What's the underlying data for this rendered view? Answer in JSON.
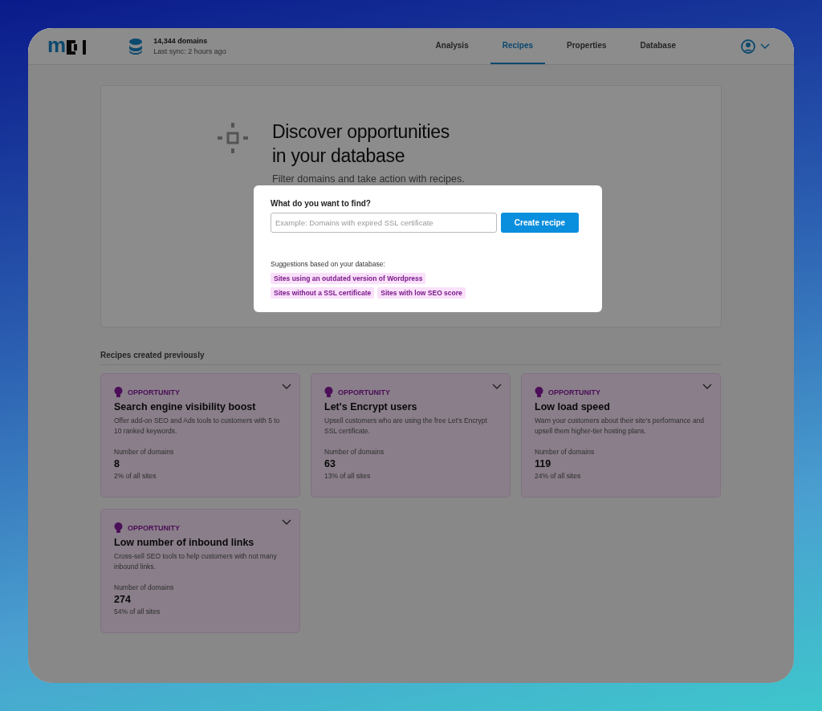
{
  "header": {
    "logo": "m",
    "domains": "14,344 domains",
    "sync": "Last sync: 2 hours ago",
    "tabs": [
      {
        "label": "Analysis",
        "selected": false
      },
      {
        "label": "Recipes",
        "selected": true
      },
      {
        "label": "Properties",
        "selected": false
      },
      {
        "label": "Database",
        "selected": false
      }
    ]
  },
  "hero": {
    "title_lines": [
      "Discover opportunities",
      "in your database"
    ],
    "subtitle": "Filter domains and take action with recipes."
  },
  "dialog": {
    "label": "What do you want to find?",
    "placeholder": "Example: Domains with expired SSL certificate",
    "button": "Create recipe",
    "suggestions_label": "Suggestions based on your database:",
    "suggestions": [
      "Sites using an outdated version of Wordpress",
      "Sites without a SSL certificate",
      "Sites with low SEO score"
    ]
  },
  "recipes": {
    "heading": "Recipes created previously",
    "cards": [
      {
        "tag": "OPPORTUNITY",
        "title": "Search engine visibility boost",
        "description": "Offer add-on SEO and Ads tools to customers with 5 to 10 ranked keywords.",
        "count_label": "Number of domains",
        "count": "8",
        "share": "2% of all sites"
      },
      {
        "tag": "OPPORTUNITY",
        "title": "Let's Encrypt users",
        "description": "Upsell customers who are using the free Let's Encrypt SSL certificate.",
        "count_label": "Number of domains",
        "count": "63",
        "share": "13% of all sites"
      },
      {
        "tag": "OPPORTUNITY",
        "title": "Low load speed",
        "description": "Warn your customers about their site's performance and upsell them higher-tier hosting plans.",
        "count_label": "Number of domains",
        "count": "119",
        "share": "24% of all sites"
      },
      {
        "tag": "OPPORTUNITY",
        "title": "Low number of inbound links",
        "description": "Cross-sell SEO tools to help customers with not many inbound links.",
        "count_label": "Number of domains",
        "count": "274",
        "share": "54% of all sites"
      }
    ]
  }
}
